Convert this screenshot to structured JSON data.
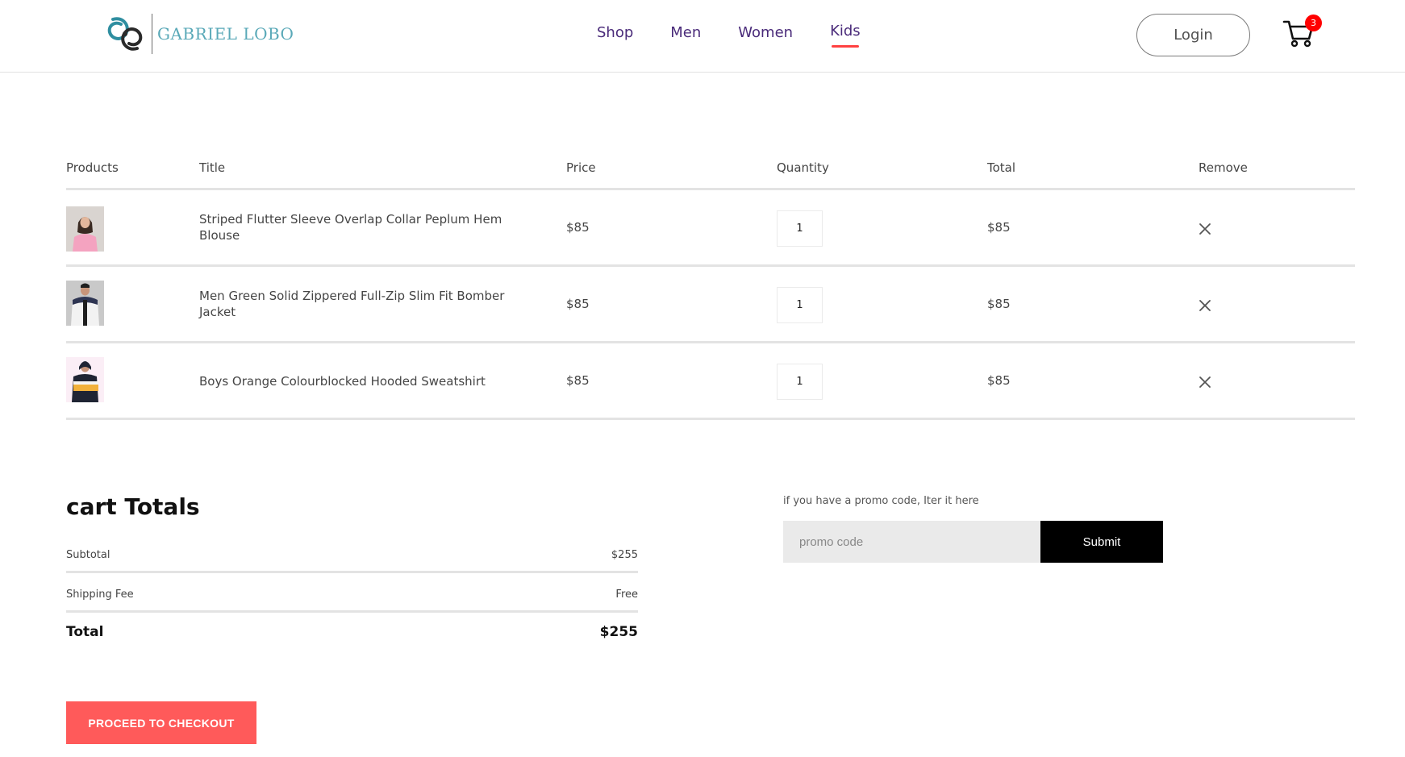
{
  "brand": {
    "name": "GABRIEL LOBO"
  },
  "nav": {
    "items": [
      {
        "label": "Shop"
      },
      {
        "label": "Men"
      },
      {
        "label": "Women"
      },
      {
        "label": "Kids",
        "active": true
      }
    ]
  },
  "header": {
    "login_label": "Login",
    "cart_count": "3"
  },
  "table": {
    "headers": {
      "products": "Products",
      "title": "Title",
      "price": "Price",
      "quantity": "Quantity",
      "total": "Total",
      "remove": "Remove"
    },
    "rows": [
      {
        "title": "Striped Flutter Sleeve Overlap Collar Peplum Hem Blouse",
        "price": "$85",
        "quantity": "1",
        "total": "$85",
        "image": "woman-pink-blouse"
      },
      {
        "title": "Men Green Solid Zippered Full-Zip Slim Fit Bomber Jacket",
        "price": "$85",
        "quantity": "1",
        "total": "$85",
        "image": "man-bomber-jacket"
      },
      {
        "title": "Boys Orange Colourblocked Hooded Sweatshirt",
        "price": "$85",
        "quantity": "1",
        "total": "$85",
        "image": "boy-hooded-sweatshirt"
      }
    ]
  },
  "totals": {
    "heading": "cart Totals",
    "subtotal_label": "Subtotal",
    "subtotal_value": "$255",
    "shipping_label": "Shipping Fee",
    "shipping_value": "Free",
    "total_label": "Total",
    "total_value": "$255",
    "checkout_label": "PROCEED TO CHECKOUT"
  },
  "promo": {
    "label": "if you have a promo code, Iter it here",
    "placeholder": "promo code",
    "submit_label": "Submit"
  },
  "colors": {
    "accent": "#ff5a5a",
    "nav_text": "#4a2b7a",
    "active_underline": "#ff4141",
    "badge": "#ff0000",
    "logo": "#5aa9b8"
  }
}
